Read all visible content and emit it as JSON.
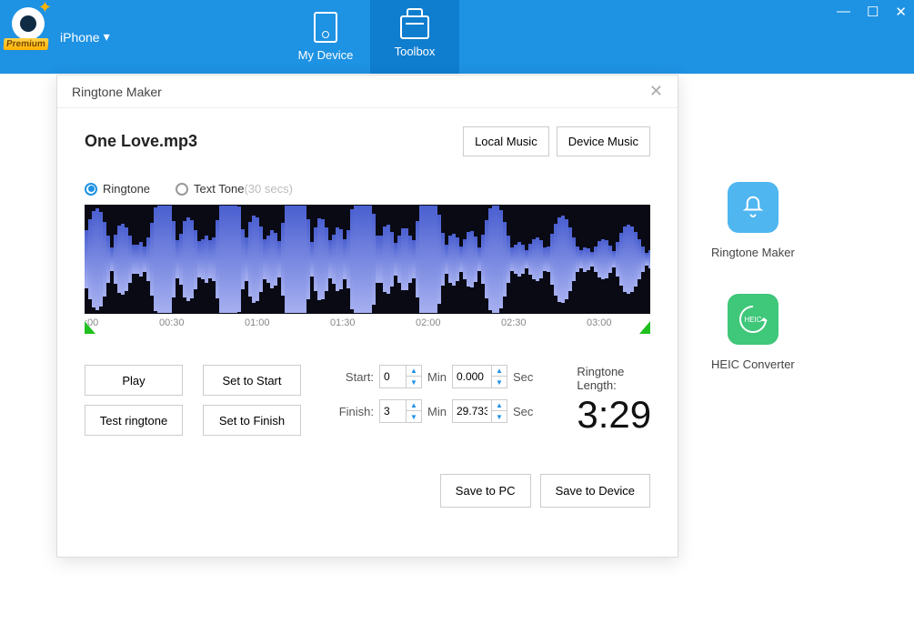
{
  "topbar": {
    "premium_label": "Premium",
    "device_name": "iPhone",
    "tabs": {
      "my_device": "My Device",
      "toolbox": "Toolbox"
    }
  },
  "side": {
    "ringtone_maker": "Ringtone Maker",
    "heic_converter": "HEIC Converter",
    "heic_text": "HEIC"
  },
  "dialog": {
    "title": "Ringtone Maker",
    "filename": "One Love.mp3",
    "local_music": "Local Music",
    "device_music": "Device Music",
    "ringtone": "Ringtone",
    "text_tone": "Text Tone",
    "text_tone_suffix": "(30 secs)",
    "play": "Play",
    "test_ringtone": "Test ringtone",
    "set_start": "Set to Start",
    "set_finish": "Set to Finish",
    "start_label": "Start:",
    "finish_label": "Finish:",
    "min_label": "Min",
    "sec_label": "Sec",
    "length_label": "Ringtone Length:",
    "length_value": "3:29",
    "time": {
      "start_min": "0",
      "start_sec": "0.000",
      "finish_min": "3",
      "finish_sec": "29.733"
    },
    "timeline": {
      "t0": ":00",
      "t1": "00:30",
      "t2": "01:00",
      "t3": "01:30",
      "t4": "02:00",
      "t5": "02:30",
      "t6": "03:00"
    },
    "save_pc": "Save to PC",
    "save_device": "Save to Device"
  }
}
